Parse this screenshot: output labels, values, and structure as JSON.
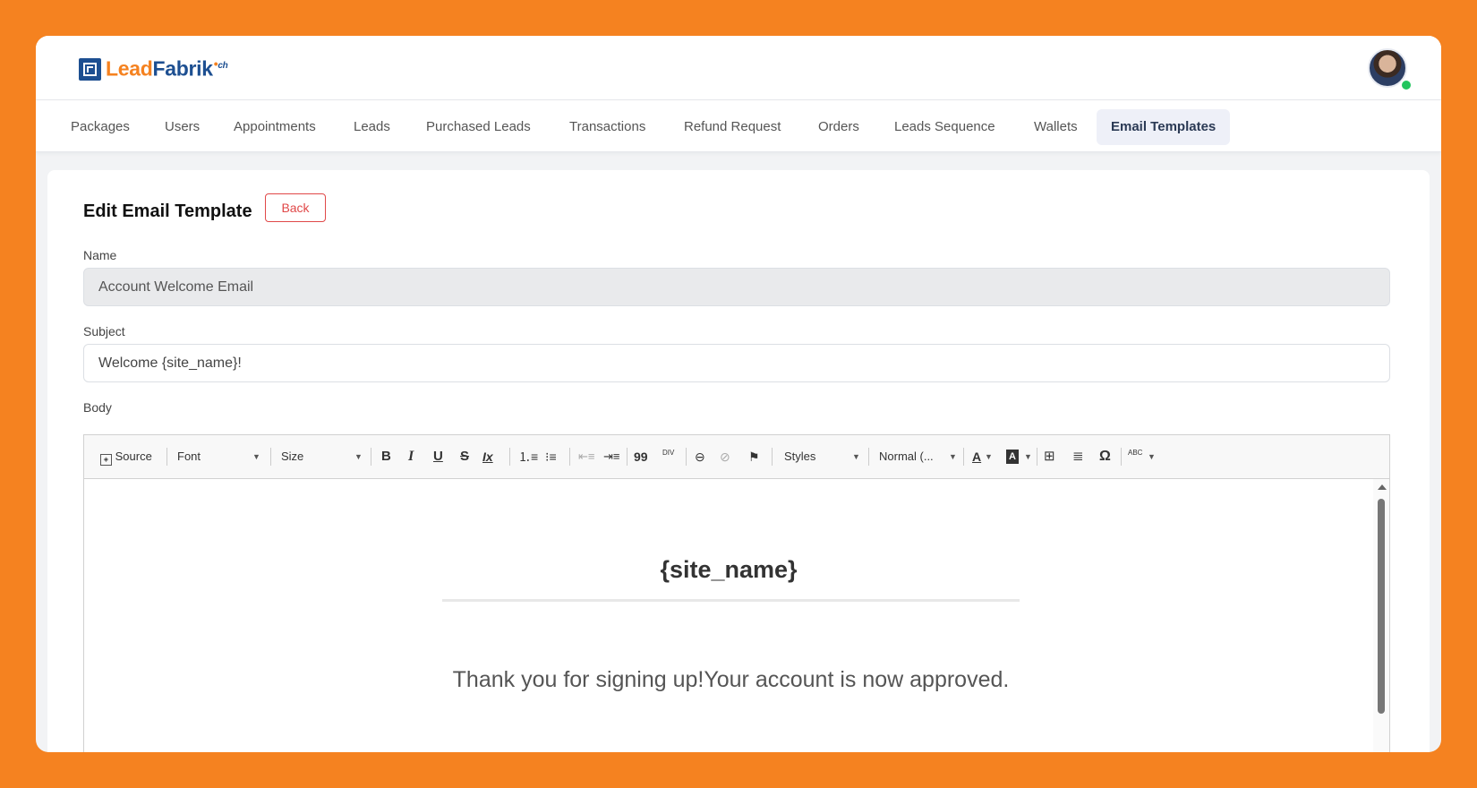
{
  "brand": {
    "lead": "Lead",
    "fabrik": "Fabrik",
    "dot": "•",
    "suffix": "ch"
  },
  "nav": {
    "items": [
      {
        "label": "Packages"
      },
      {
        "label": "Users"
      },
      {
        "label": "Appointments"
      },
      {
        "label": "Leads"
      },
      {
        "label": "Purchased Leads"
      },
      {
        "label": "Transactions"
      },
      {
        "label": "Refund Request"
      },
      {
        "label": "Orders"
      },
      {
        "label": "Leads Sequence"
      },
      {
        "label": "Wallets"
      },
      {
        "label": "Email Templates",
        "active": true
      }
    ]
  },
  "form": {
    "title": "Edit Email Template",
    "back_label": "Back",
    "name_label": "Name",
    "name_value": "Account Welcome Email",
    "subject_label": "Subject",
    "subject_value": "Welcome {site_name}!",
    "body_label": "Body"
  },
  "toolbar": {
    "source": "Source",
    "font": "Font",
    "size": "Size",
    "bold": "B",
    "italic": "I",
    "underline": "U",
    "strike": "S",
    "remove_format": "Ix",
    "blockquote": "99",
    "div": "DIV",
    "styles": "Styles",
    "format": "Normal (...",
    "text_color": "A",
    "bg_color": "A",
    "special_char": "Ω",
    "spell": "ABC"
  },
  "editor": {
    "heading": "{site_name}",
    "text": "Thank you for signing up!Your account is now approved."
  },
  "colors": {
    "background": "#f58220",
    "brand_blue": "#1d4f91",
    "danger": "#e04848"
  }
}
